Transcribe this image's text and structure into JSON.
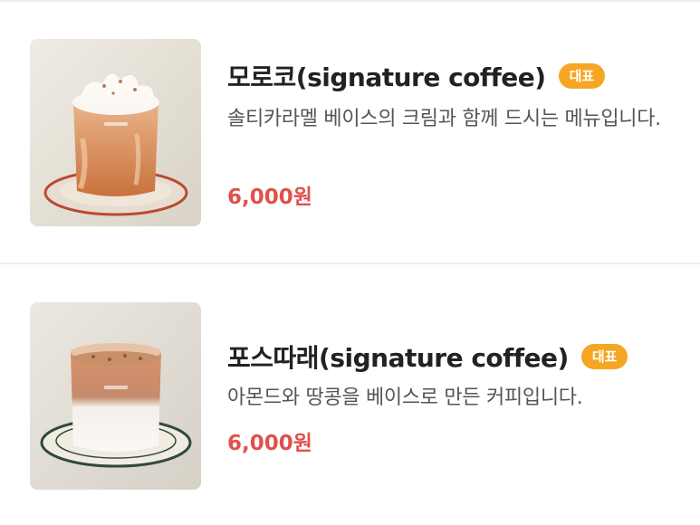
{
  "menu": {
    "items": [
      {
        "title": "모로코(signature coffee)",
        "badge": "대표",
        "description": "솔티카라멜 베이스의 크림과 함께 드시는 메뉴입니다.",
        "price": "6,000원"
      },
      {
        "title": "포스따래(signature coffee)",
        "badge": "대표",
        "description": "아몬드와 땅콩을 베이스로 만든 커피입니다.",
        "price": "6,000원"
      }
    ]
  },
  "colors": {
    "badge": "#f5a623",
    "price": "#e0514b",
    "divider": "#ececec"
  }
}
